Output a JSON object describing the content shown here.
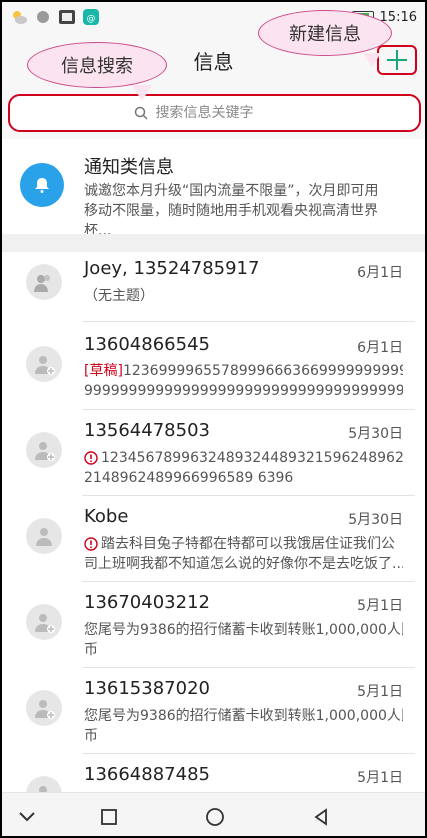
{
  "status_bar": {
    "time": "15:16"
  },
  "app_bar": {
    "title": "信息"
  },
  "annotations": {
    "search_label": "信息搜索",
    "new_label": "新建信息"
  },
  "search": {
    "placeholder": "搜索信息关键字"
  },
  "notification": {
    "title": "通知类信息",
    "preview_line1": "诚邀您本月升级“国内流量不限量”，次月即可用",
    "preview_line2": "移动不限量，随时随地用手机观看央视高清世界杯..."
  },
  "messages": [
    {
      "name": "Joey, 13524785917",
      "date": "6月1日",
      "line1": "（无主题）",
      "line2": ""
    },
    {
      "name": "13604866545",
      "date": "6月1日",
      "draft_tag": "[草稿]",
      "line1": "1236999965578999666366999999999999999",
      "line2": "9999999999999999999999999999999999999999..."
    },
    {
      "name": "13564478503",
      "date": "5月30日",
      "line1": "123456789963248932448932159624896217896",
      "line2": "2148962489966996589 6396"
    },
    {
      "name": "Kobe",
      "date": "5月30日",
      "line1": "踏去科目兔子特都在特都可以我饿居住证我们公",
      "line2": "司上班啊我都不知道怎么说的好像你不是去吃饭了..."
    },
    {
      "name": "13670403212",
      "date": "5月1日",
      "line1": "您尾号为9386的招行储蓄卡收到转账1,000,000人民",
      "line2": "币"
    },
    {
      "name": "13615387020",
      "date": "5月1日",
      "line1": "您尾号为9386的招行储蓄卡收到转账1,000,000人民",
      "line2": "币"
    },
    {
      "name": "13664887485",
      "date": "5月1日",
      "line1": "",
      "line2": ""
    }
  ]
}
